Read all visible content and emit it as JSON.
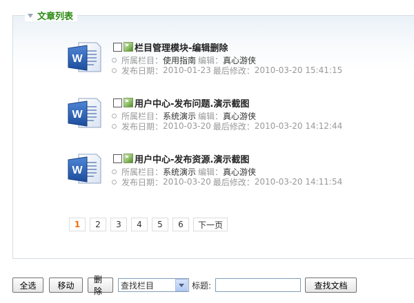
{
  "section": {
    "title": "文章列表"
  },
  "articles": [
    {
      "title": "栏目管理模块-编辑删除",
      "column_label": "所属栏目：",
      "column": "使用指南",
      "editor_label": "编辑：",
      "editor": "真心游侠",
      "date_label": "发布日期：",
      "date": "2010-01-23",
      "modified_label": "最后修改：",
      "modified": "2010-03-20 15:41:15"
    },
    {
      "title": "用户中心-发布问题.演示截图",
      "column_label": "所属栏目：",
      "column": "系统演示",
      "editor_label": "编辑：",
      "editor": "真心游侠",
      "date_label": "发布日期：",
      "date": "2010-03-20",
      "modified_label": "最后修改：",
      "modified": "2010-03-20 14:12:44"
    },
    {
      "title": "用户中心-发布资源.演示截图",
      "column_label": "所属栏目：",
      "column": "系统演示",
      "editor_label": "编辑：",
      "editor": "真心游侠",
      "date_label": "发布日期：",
      "date": "2010-03-20",
      "modified_label": "最后修改：",
      "modified": "2010-03-20 14:11:54"
    }
  ],
  "pagination": {
    "pages": [
      "1",
      "2",
      "3",
      "4",
      "5",
      "6"
    ],
    "current": "1",
    "next_label": "下一页"
  },
  "toolbar": {
    "select_all_label": "全选",
    "move_label": "移动",
    "delete_label": "删除",
    "column_select_value": "查找栏目",
    "title_label": "标题:",
    "title_input_value": "",
    "search_label": "查找文档"
  },
  "colors": {
    "legend_title": "#2a8a12",
    "current_page": "#f26b0a"
  },
  "icons": {
    "document": "word-document-icon",
    "thumbnail": "image-thumbnail-icon"
  }
}
